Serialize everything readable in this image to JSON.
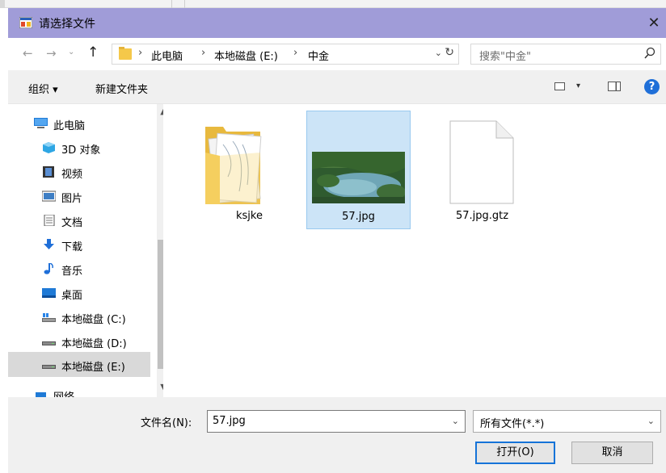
{
  "window": {
    "title": "请选择文件",
    "close_glyph": "✕"
  },
  "nav": {
    "back": "←",
    "forward": "→",
    "recent": "⌄",
    "up": "↑"
  },
  "address": {
    "crumbs": [
      "此电脑",
      "本地磁盘 (E:)",
      "中金"
    ],
    "separator": "›",
    "dropdown": "⌄",
    "refresh": "↻"
  },
  "search": {
    "placeholder": "搜索\"中金\"",
    "icon": "⚲"
  },
  "toolbar": {
    "organize": "组织 ▾",
    "new_folder": "新建文件夹",
    "view_drop": "▾",
    "help": "?"
  },
  "sidebar": {
    "items": [
      {
        "label": "此电脑",
        "icon": "computer-icon"
      },
      {
        "label": "3D 对象",
        "icon": "cube-icon"
      },
      {
        "label": "视频",
        "icon": "video-icon"
      },
      {
        "label": "图片",
        "icon": "picture-icon"
      },
      {
        "label": "文档",
        "icon": "document-icon"
      },
      {
        "label": "下载",
        "icon": "download-icon"
      },
      {
        "label": "音乐",
        "icon": "music-icon"
      },
      {
        "label": "桌面",
        "icon": "desktop-icon"
      },
      {
        "label": "本地磁盘 (C:)",
        "icon": "drive-c-icon"
      },
      {
        "label": "本地磁盘 (D:)",
        "icon": "drive-icon"
      },
      {
        "label": "本地磁盘 (E:)",
        "icon": "drive-icon",
        "selected": true
      },
      {
        "label": "网络",
        "icon": "network-icon"
      }
    ],
    "scroll_up": "▲",
    "scroll_down": "▼"
  },
  "files": [
    {
      "name": "ksjke",
      "type": "folder"
    },
    {
      "name": "57.jpg",
      "type": "image",
      "selected": true
    },
    {
      "name": "57.jpg.gtz",
      "type": "file"
    }
  ],
  "bottom": {
    "filename_label": "文件名(N):",
    "filename_value": "57.jpg",
    "filetype_value": "所有文件(*.*)",
    "dropdown": "⌄",
    "open_label": "打开(O)",
    "cancel_label": "取消"
  }
}
